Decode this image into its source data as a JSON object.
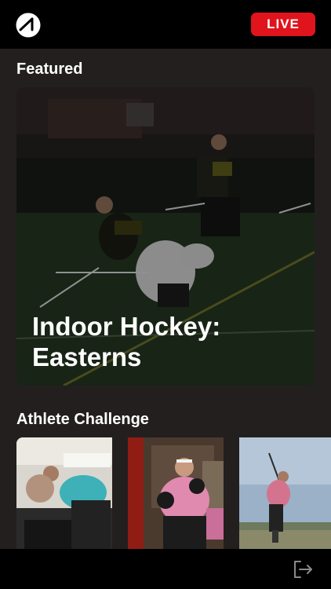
{
  "header": {
    "logo_icon": "brand-slash-circle-icon",
    "live_label": "LIVE",
    "live_color": "#e0141c"
  },
  "featured": {
    "section_title": "Featured",
    "card_title": "Indoor Hockey: Easterns"
  },
  "athlete_challenge": {
    "section_title": "Athlete Challenge"
  },
  "footer": {
    "logout_icon": "logout-icon"
  }
}
